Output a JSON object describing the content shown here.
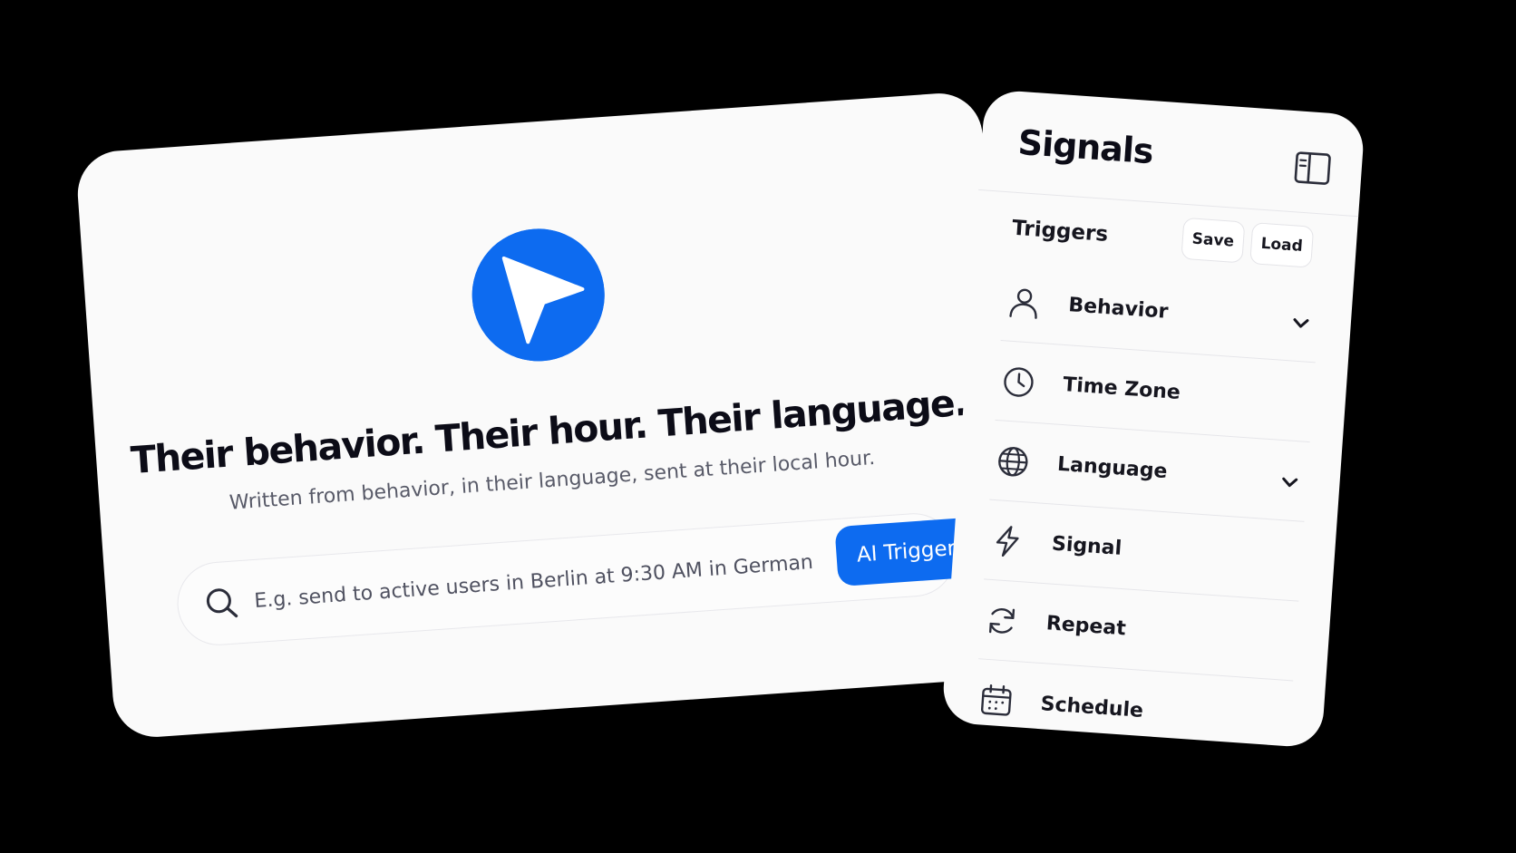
{
  "hero": {
    "logo_icon": "navigation-arrow-icon",
    "title": "Their behavior. Their hour. Their language.",
    "subtitle": "Written from behavior, in their language, sent at their local hour.",
    "search": {
      "icon": "search-icon",
      "placeholder": "E.g. send to active users in Berlin at 9:30 AM in German",
      "value": ""
    },
    "ai_trigger_label": "AI Trigger"
  },
  "signals": {
    "title": "Signals",
    "sidebar_toggle_icon": "sidebar-panel-icon",
    "triggers_label": "Triggers",
    "save_label": "Save",
    "load_label": "Load",
    "items": [
      {
        "label": "Behavior",
        "icon": "user-icon",
        "has_dropdown": true
      },
      {
        "label": "Time Zone",
        "icon": "clock-icon",
        "has_dropdown": false
      },
      {
        "label": "Language",
        "icon": "globe-icon",
        "has_dropdown": true
      },
      {
        "label": "Signal",
        "icon": "lightning-bolt-icon",
        "has_dropdown": false
      },
      {
        "label": "Repeat",
        "icon": "refresh-icon",
        "has_dropdown": false
      },
      {
        "label": "Schedule",
        "icon": "calendar-icon",
        "has_dropdown": false
      }
    ]
  },
  "colors": {
    "accent": "#0d6bf0",
    "background": "#000000",
    "card": "#fafafa",
    "text_primary": "#0c0c17",
    "text_secondary": "#585a68"
  }
}
